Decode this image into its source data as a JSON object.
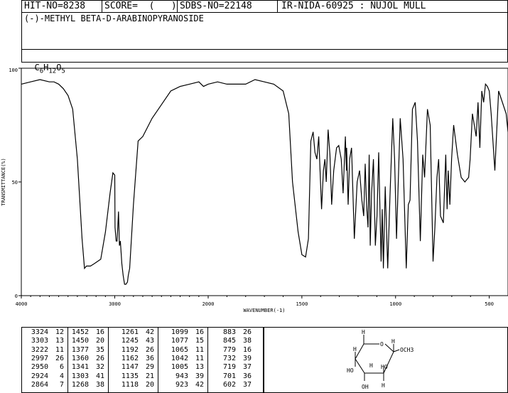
{
  "header": {
    "hit_no": "HIT-NO=8238",
    "score": "SCORE=  (   )",
    "sdbs_no": "SDBS-NO=22148",
    "ir_info": "IR-NIDA-60925 : NUJOL MULL",
    "compound_name": "(-)-METHYL BETA-D-ARABINOPYRANOSIDE",
    "formula_parts": [
      "C",
      "6",
      "H",
      "12",
      "O",
      "5"
    ]
  },
  "chart_data": {
    "type": "line",
    "title": "",
    "xlabel": "WAVENUMBER(-1)",
    "ylabel": "TRANSMITTANCE(%)",
    "xlim": [
      4000,
      400
    ],
    "ylim": [
      0,
      100
    ],
    "x_ticks": [
      "4000",
      "3000",
      "2000",
      "1500",
      "1000",
      "500"
    ],
    "y_ticks": [
      "100",
      "50",
      "0"
    ],
    "x": [
      4000,
      3900,
      3800,
      3700,
      3650,
      3600,
      3550,
      3500,
      3450,
      3400,
      3350,
      3324,
      3303,
      3260,
      3222,
      3150,
      3100,
      3050,
      3020,
      3000,
      2997,
      2985,
      2975,
      2960,
      2950,
      2940,
      2924,
      2910,
      2895,
      2880,
      2864,
      2855,
      2840,
      2800,
      2750,
      2700,
      2600,
      2500,
      2400,
      2300,
      2200,
      2100,
      2050,
      2000,
      1950,
      1900,
      1800,
      1750,
      1700,
      1650,
      1600,
      1570,
      1550,
      1520,
      1500,
      1480,
      1465,
      1452,
      1440,
      1430,
      1420,
      1410,
      1395,
      1385,
      1377,
      1370,
      1360,
      1350,
      1341,
      1330,
      1315,
      1303,
      1290,
      1280,
      1268,
      1262,
      1261,
      1253,
      1245,
      1235,
      1220,
      1205,
      1192,
      1180,
      1170,
      1162,
      1155,
      1147,
      1141,
      1135,
      1128,
      1118,
      1108,
      1099,
      1090,
      1077,
      1071,
      1065,
      1055,
      1042,
      1030,
      1015,
      1005,
      995,
      975,
      960,
      943,
      932,
      923,
      910,
      895,
      883,
      868,
      855,
      845,
      830,
      815,
      800,
      790,
      779,
      770,
      760,
      745,
      732,
      725,
      719,
      710,
      701,
      690,
      670,
      650,
      630,
      610,
      602,
      590,
      570,
      560,
      550,
      540,
      530,
      520,
      510,
      500,
      490,
      470,
      450,
      430,
      410,
      400
    ],
    "y": [
      93,
      94,
      95,
      94,
      94,
      93,
      91,
      88,
      82,
      60,
      25,
      12,
      13,
      13,
      14,
      16,
      28,
      45,
      54,
      53,
      30,
      24,
      24,
      37,
      22,
      24,
      14,
      9,
      5,
      5,
      6,
      9,
      12,
      40,
      68,
      70,
      78,
      84,
      90,
      92,
      93,
      94,
      92,
      93,
      94,
      93,
      93,
      95,
      94,
      93,
      90,
      80,
      50,
      28,
      18,
      17,
      25,
      68,
      72,
      63,
      60,
      70,
      38,
      55,
      60,
      50,
      73,
      62,
      40,
      55,
      65,
      66,
      60,
      45,
      70,
      55,
      65,
      40,
      60,
      65,
      25,
      50,
      55,
      42,
      35,
      58,
      40,
      30,
      62,
      22,
      45,
      60,
      22,
      35,
      63,
      15,
      38,
      12,
      48,
      12,
      43,
      78,
      60,
      25,
      78,
      60,
      12,
      40,
      42,
      82,
      85,
      68,
      24,
      62,
      52,
      82,
      75,
      15,
      30,
      52,
      60,
      35,
      32,
      62,
      38,
      55,
      40,
      60,
      75,
      62,
      52,
      50,
      52,
      60,
      80,
      70,
      85,
      65,
      90,
      85,
      93,
      92,
      90,
      80,
      55,
      90,
      85,
      80,
      72,
      70,
      70
    ]
  },
  "peaks": {
    "columns": [
      [
        [
          "3324",
          "12"
        ],
        [
          "3303",
          "13"
        ],
        [
          "3222",
          "11"
        ],
        [
          "2997",
          "26"
        ],
        [
          "2950",
          "6"
        ],
        [
          "2924",
          "4"
        ],
        [
          "2864",
          "7"
        ]
      ],
      [
        [
          "1452",
          "16"
        ],
        [
          "1450",
          "20"
        ],
        [
          "1377",
          "35"
        ],
        [
          "1360",
          "26"
        ],
        [
          "1341",
          "32"
        ],
        [
          "1303",
          "41"
        ],
        [
          "1268",
          "38"
        ]
      ],
      [
        [
          "1261",
          "42"
        ],
        [
          "1245",
          "43"
        ],
        [
          "1192",
          "26"
        ],
        [
          "1162",
          "36"
        ],
        [
          "1147",
          "29"
        ],
        [
          "1135",
          "21"
        ],
        [
          "1118",
          "20"
        ]
      ],
      [
        [
          "1099",
          "16"
        ],
        [
          "1077",
          "15"
        ],
        [
          "1065",
          "11"
        ],
        [
          "1042",
          "11"
        ],
        [
          "1005",
          "13"
        ],
        [
          "943",
          "39"
        ],
        [
          "923",
          "42"
        ]
      ],
      [
        [
          "883",
          "26"
        ],
        [
          "845",
          "38"
        ],
        [
          "779",
          "16"
        ],
        [
          "732",
          "39"
        ],
        [
          "719",
          "37"
        ],
        [
          "701",
          "36"
        ],
        [
          "602",
          "37"
        ]
      ]
    ]
  },
  "structure": {
    "labels": [
      "H",
      "O",
      "OCH3",
      "H",
      "H",
      "HO",
      "HO",
      "H",
      "H",
      "OH"
    ]
  }
}
